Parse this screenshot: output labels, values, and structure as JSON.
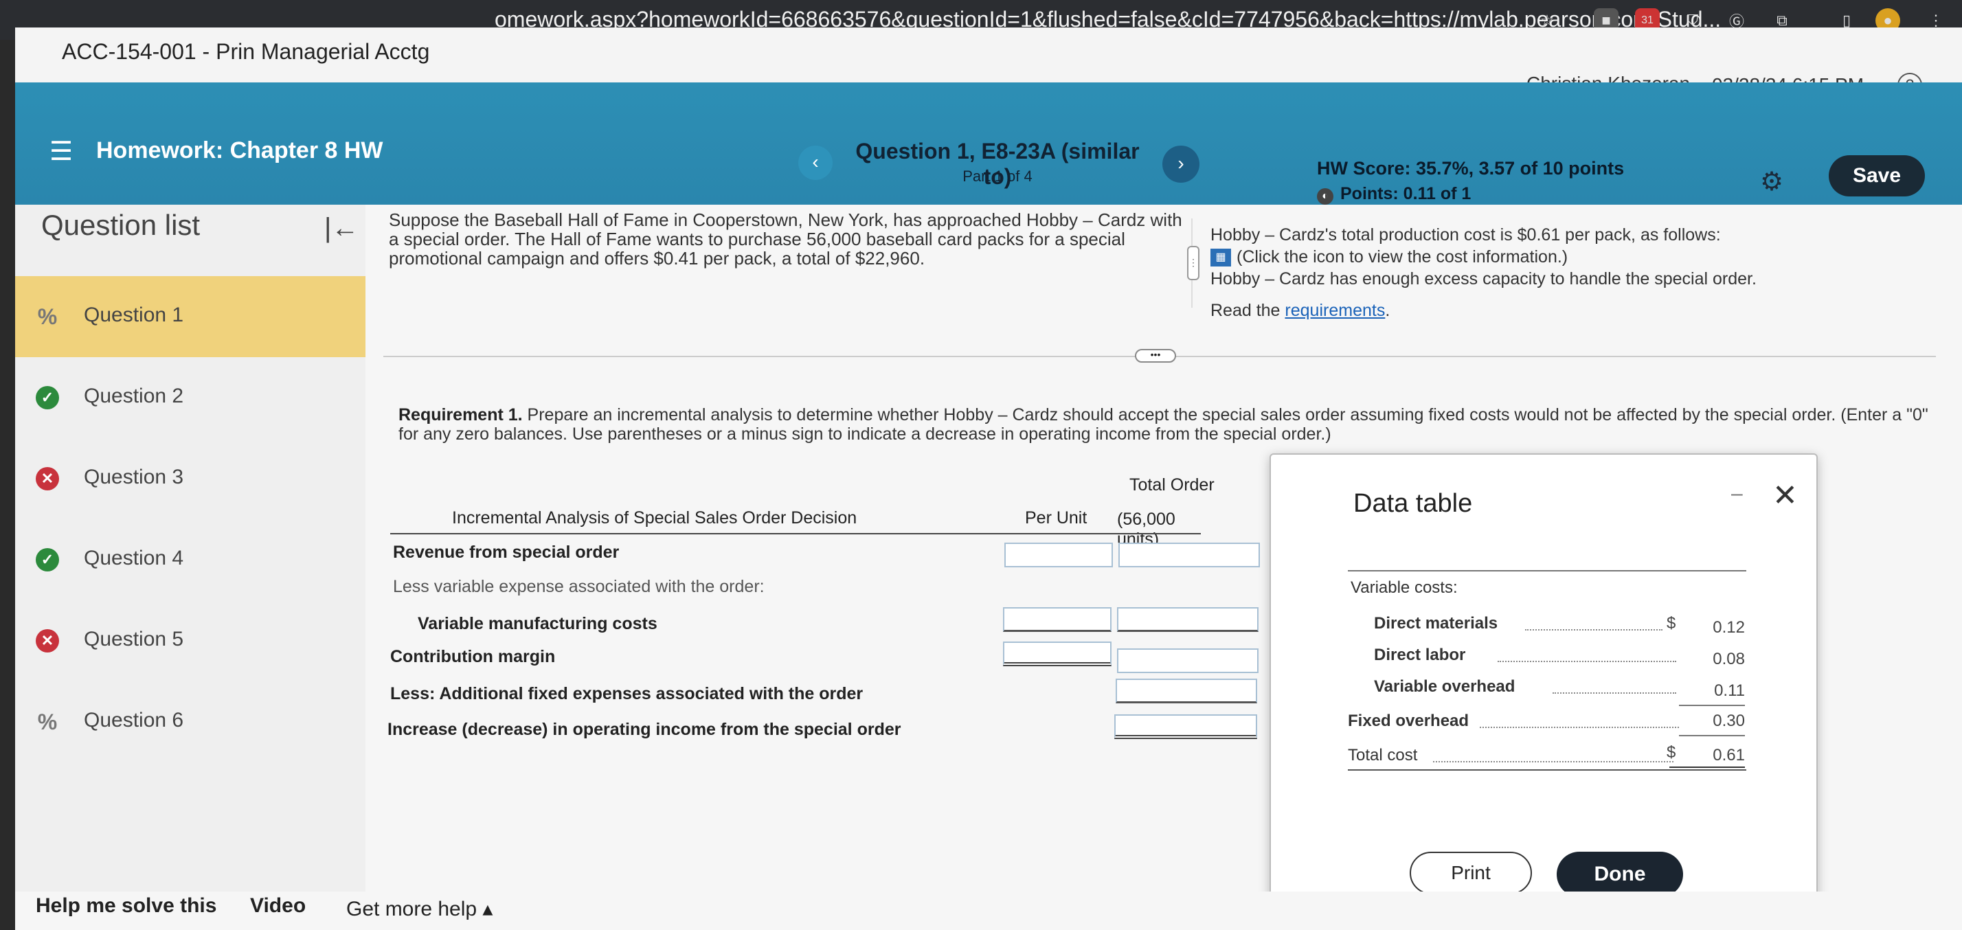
{
  "browser": {
    "url": "omework.aspx?homeworkId=668663576&questionId=1&flushed=false&cId=7747956&back=https://mylab.pearson.com/Stud...",
    "calendar_badge": "31"
  },
  "header": {
    "course_title": "ACC-154-001 - Prin Managerial Acctg",
    "student_name": "Christian Khezeran",
    "datetime": "03/28/24 6:15 PM",
    "help_icon": "?"
  },
  "hwbar": {
    "title": "Homework: Chapter 8 HW",
    "question_title": "Question 1, E8-23A (similar to)",
    "part": "Part 1 of 4",
    "hw_score": "HW Score: 35.7%, 3.57 of 10 points",
    "points": "Points: 0.11 of 1",
    "save_label": "Save"
  },
  "sidebar": {
    "title": "Question list",
    "items": [
      {
        "label": "Question 1",
        "status": "partial"
      },
      {
        "label": "Question 2",
        "status": "correct"
      },
      {
        "label": "Question 3",
        "status": "incorrect"
      },
      {
        "label": "Question 4",
        "status": "correct"
      },
      {
        "label": "Question 5",
        "status": "incorrect"
      },
      {
        "label": "Question 6",
        "status": "partial"
      }
    ]
  },
  "problem": {
    "left_text": "Suppose the Baseball Hall of Fame in Cooperstown, New York, has approached Hobby – Cardz with a special order. The Hall of Fame wants to purchase 56,000 baseball card packs for a special promotional campaign and offers $0.41 per pack, a total of $22,960.",
    "right_line1": "Hobby – Cardz's total production cost is $0.61 per pack, as follows:",
    "right_line2": "(Click the icon to view the cost information.)",
    "right_line3": "Hobby – Cardz has enough excess capacity to handle the special order.",
    "read_prefix": "Read the ",
    "read_link": "requirements",
    "read_suffix": "."
  },
  "requirement": {
    "bold": "Requirement 1.",
    "text": " Prepare an incremental analysis to determine whether Hobby – Cardz should accept the special sales order assuming fixed costs would not be affected by the special order. (Enter a \"0\" for any zero balances. Use parentheses or a minus sign to indicate a decrease in operating income from the special order.)"
  },
  "analysis": {
    "heading": "Incremental Analysis of Special Sales Order Decision",
    "col_per_unit": "Per Unit",
    "col_total_1": "Total Order",
    "col_total_2": "(56,000 units)",
    "rows": [
      "Revenue from special order",
      "Less variable expense associated with the order:",
      "Variable manufacturing costs",
      "Contribution margin",
      "Less: Additional fixed expenses associated with the order",
      "Increase (decrease) in operating income from the special order"
    ]
  },
  "modal": {
    "title": "Data table",
    "variable_costs": "Variable costs:",
    "direct_materials": "Direct materials",
    "direct_labor": "Direct labor",
    "variable_overhead": "Variable overhead",
    "fixed_overhead": "Fixed overhead",
    "total_cost": "Total cost",
    "dollar": "$",
    "v_dm": "0.12",
    "v_dl": "0.08",
    "v_vo": "0.11",
    "v_fo": "0.30",
    "v_total": "0.61",
    "print_label": "Print",
    "done_label": "Done"
  },
  "footer": {
    "help_me": "Help me solve this",
    "video": "Video",
    "more_help": "Get more help ▴"
  },
  "colors": {
    "hwbar": "#2d8fb5",
    "active_question": "#f0d27c",
    "correct": "#2c8a3c",
    "incorrect": "#c8323c",
    "save_button": "#1a2a36"
  }
}
